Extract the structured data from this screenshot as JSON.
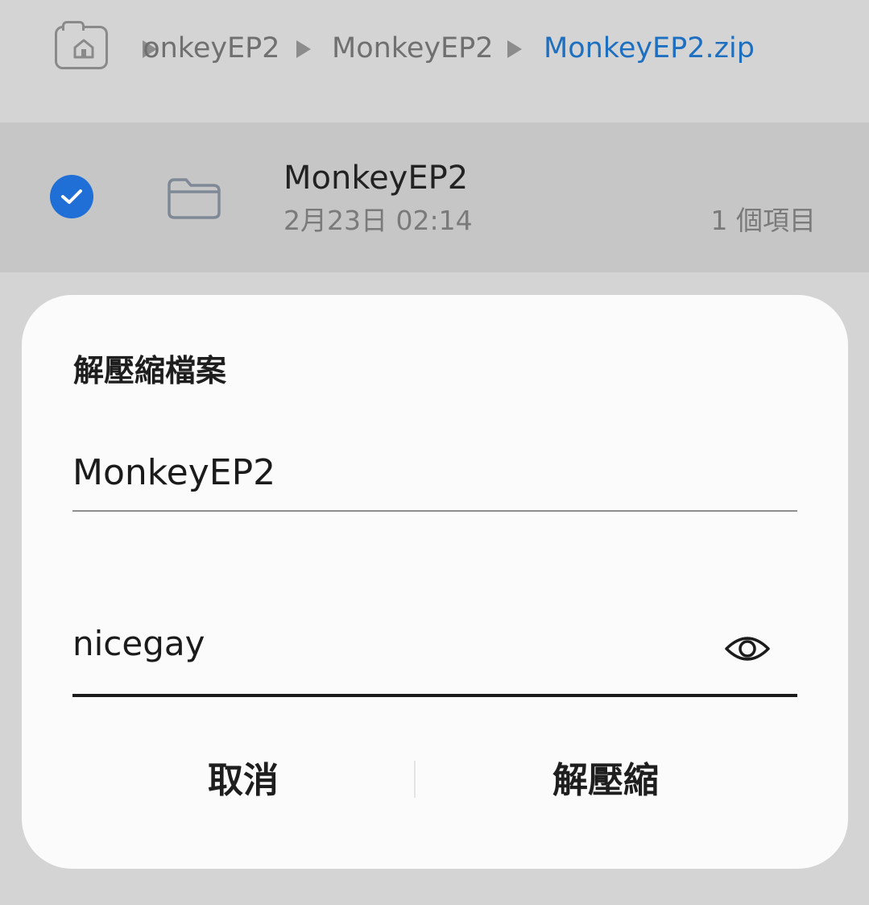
{
  "breadcrumb": {
    "items": [
      {
        "label": "MonkeyEP2"
      },
      {
        "label": "MonkeyEP2"
      },
      {
        "label": "MonkeyEP2.zip"
      }
    ]
  },
  "row": {
    "name": "MonkeyEP2",
    "date": "2月23日 02:14",
    "count": "1 個項目",
    "selected": true
  },
  "dialog": {
    "title": "解壓縮檔案",
    "name_value": "MonkeyEP2",
    "password_value": "nicegay",
    "cancel_label": "取消",
    "extract_label": "解壓縮"
  },
  "colors": {
    "accent": "#1f6fd6",
    "breadcrumb_active": "#1f6fc0",
    "background": "#d4d4d4",
    "selected_row": "#c6c6c6",
    "dialog_bg": "#fbfbfb"
  },
  "icons": {
    "home": "home-icon",
    "check": "check-circle-icon",
    "folder": "folder-icon",
    "eye": "eye-icon",
    "separator": "triangle-right-icon"
  }
}
